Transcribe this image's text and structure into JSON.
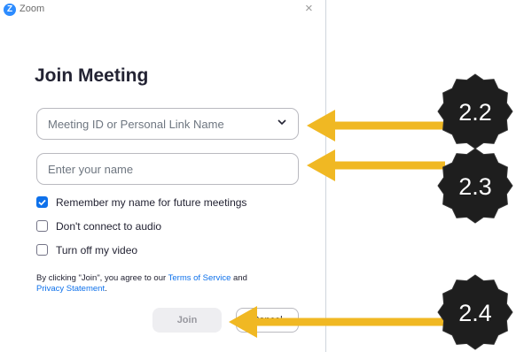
{
  "window": {
    "title": "Zoom",
    "logo_letter": "Z",
    "close_glyph": "×"
  },
  "heading": "Join Meeting",
  "meeting_id_field": {
    "placeholder": "Meeting ID or Personal Link Name"
  },
  "name_field": {
    "placeholder": "Enter your name"
  },
  "options": [
    {
      "label": "Remember my name for future meetings",
      "checked": true
    },
    {
      "label": "Don't connect to audio",
      "checked": false
    },
    {
      "label": "Turn off my video",
      "checked": false
    }
  ],
  "terms": {
    "prefix": "By clicking \"Join\", you agree to our ",
    "terms_link": "Terms of Service",
    "middle": " and",
    "privacy_link": "Privacy Statement",
    "suffix": "."
  },
  "buttons": {
    "join": "Join",
    "cancel": "Cancel"
  },
  "annotations": [
    {
      "label": "2.2",
      "target": "meeting-id-field"
    },
    {
      "label": "2.3",
      "target": "name-field"
    },
    {
      "label": "2.4",
      "target": "join-button"
    }
  ],
  "colors": {
    "accent": "#0e71eb",
    "arrow": "#f0b823",
    "badge": "#1e1e1e"
  }
}
